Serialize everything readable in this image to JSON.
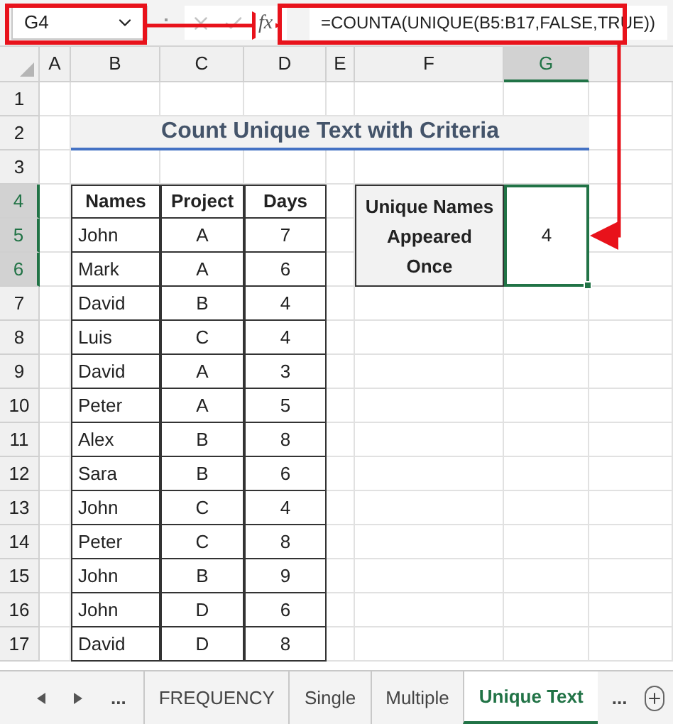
{
  "name_box": {
    "value": "G4"
  },
  "formula_bar": {
    "function_label": "fx",
    "formula": "=COUNTA(UNIQUE(B5:B17,FALSE,TRUE))"
  },
  "columns": [
    {
      "label": "A",
      "selected": false
    },
    {
      "label": "B",
      "selected": false
    },
    {
      "label": "C",
      "selected": false
    },
    {
      "label": "D",
      "selected": false
    },
    {
      "label": "E",
      "selected": false
    },
    {
      "label": "F",
      "selected": false
    },
    {
      "label": "G",
      "selected": true
    }
  ],
  "rows": [
    {
      "label": "1",
      "selected": false
    },
    {
      "label": "2",
      "selected": false
    },
    {
      "label": "3",
      "selected": false
    },
    {
      "label": "4",
      "selected": true
    },
    {
      "label": "5",
      "selected": true
    },
    {
      "label": "6",
      "selected": true
    },
    {
      "label": "7",
      "selected": false
    },
    {
      "label": "8",
      "selected": false
    },
    {
      "label": "9",
      "selected": false
    },
    {
      "label": "10",
      "selected": false
    },
    {
      "label": "11",
      "selected": false
    },
    {
      "label": "12",
      "selected": false
    },
    {
      "label": "13",
      "selected": false
    },
    {
      "label": "14",
      "selected": false
    },
    {
      "label": "15",
      "selected": false
    },
    {
      "label": "16",
      "selected": false
    },
    {
      "label": "17",
      "selected": false
    }
  ],
  "title": "Count Unique Text with Criteria",
  "table": {
    "columns": [
      "Names",
      "Project",
      "Days"
    ],
    "rows": [
      [
        "John",
        "A",
        "7"
      ],
      [
        "Mark",
        "A",
        "6"
      ],
      [
        "David",
        "B",
        "4"
      ],
      [
        "Luis",
        "C",
        "4"
      ],
      [
        "David",
        "A",
        "3"
      ],
      [
        "Peter",
        "A",
        "5"
      ],
      [
        "Alex",
        "B",
        "8"
      ],
      [
        "Sara",
        "B",
        "6"
      ],
      [
        "John",
        "C",
        "4"
      ],
      [
        "Peter",
        "C",
        "8"
      ],
      [
        "John",
        "B",
        "9"
      ],
      [
        "John",
        "D",
        "6"
      ],
      [
        "David",
        "D",
        "8"
      ]
    ]
  },
  "result": {
    "label": "Unique Names Appeared Once",
    "value": "4"
  },
  "sheet_tabs": {
    "leading": "...",
    "tabs": [
      {
        "label": "FREQUENCY",
        "selected": false
      },
      {
        "label": "Single",
        "selected": false
      },
      {
        "label": "Multiple",
        "selected": false
      },
      {
        "label": "Unique Text",
        "selected": true
      }
    ],
    "trailing": "..."
  }
}
